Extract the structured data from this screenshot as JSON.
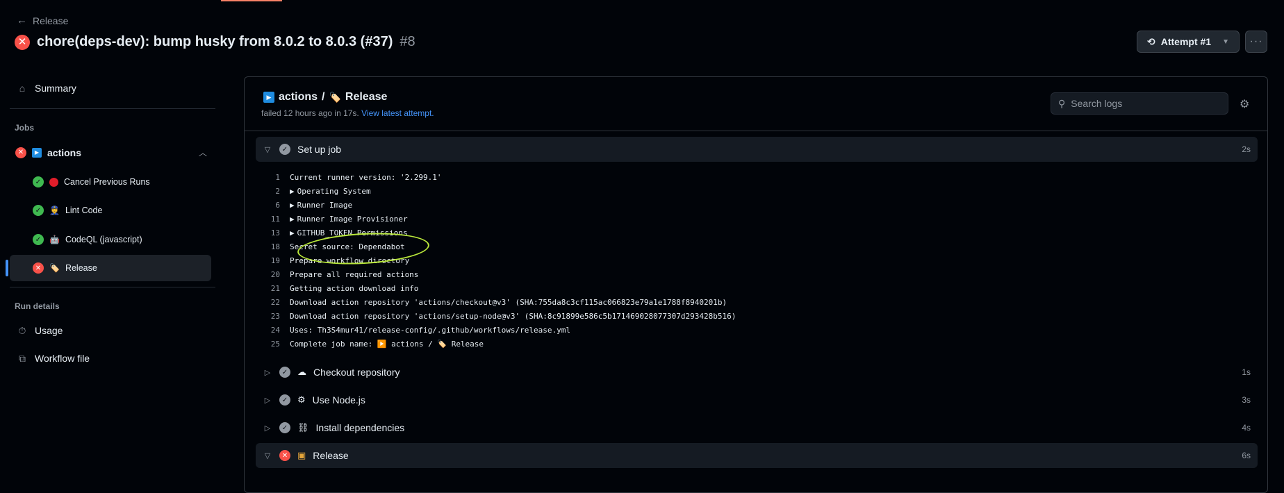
{
  "header": {
    "back_label": "Release",
    "run_title": "chore(deps-dev): bump husky from 8.0.2 to 8.0.3 (#37)",
    "run_number": "#8",
    "attempt_label": "Attempt #1",
    "more_label": "···"
  },
  "sidebar": {
    "summary_label": "Summary",
    "jobs_label": "Jobs",
    "job_group": "actions",
    "sub_jobs": [
      {
        "label": "Cancel Previous Runs",
        "status": "success"
      },
      {
        "label": "Lint Code",
        "status": "success"
      },
      {
        "label": "CodeQL (javascript)",
        "status": "success"
      },
      {
        "label": "Release",
        "status": "failure"
      }
    ],
    "run_details_label": "Run details",
    "usage_label": "Usage",
    "workflow_file_label": "Workflow file"
  },
  "panel": {
    "title_prefix": "actions",
    "title_sep": "/",
    "title_job": "Release",
    "status_text": "failed 12 hours ago in 17s.",
    "latest_link": "View latest attempt.",
    "search_placeholder": "Search logs"
  },
  "steps": [
    {
      "name": "Set up job",
      "duration": "2s",
      "status": "success",
      "expanded": true
    },
    {
      "name": "Checkout repository",
      "duration": "1s",
      "status": "success",
      "expanded": false
    },
    {
      "name": "Use Node.js",
      "duration": "3s",
      "status": "success",
      "expanded": false
    },
    {
      "name": "Install dependencies",
      "duration": "4s",
      "status": "success",
      "expanded": false
    },
    {
      "name": "Release",
      "duration": "6s",
      "status": "failure",
      "expanded": true
    }
  ],
  "log": [
    {
      "n": "1",
      "text": "Current runner version: '2.299.1'",
      "group": false
    },
    {
      "n": "2",
      "text": "Operating System",
      "group": true
    },
    {
      "n": "6",
      "text": "Runner Image",
      "group": true
    },
    {
      "n": "11",
      "text": "Runner Image Provisioner",
      "group": true
    },
    {
      "n": "13",
      "text": "GITHUB_TOKEN Permissions",
      "group": true
    },
    {
      "n": "18",
      "text": "Secret source: Dependabot",
      "group": false
    },
    {
      "n": "19",
      "text": "Prepare workflow directory",
      "group": false
    },
    {
      "n": "20",
      "text": "Prepare all required actions",
      "group": false
    },
    {
      "n": "21",
      "text": "Getting action download info",
      "group": false
    },
    {
      "n": "22",
      "text": "Download action repository 'actions/checkout@v3' (SHA:755da8c3cf115ac066823e79a1e1788f8940201b)",
      "group": false
    },
    {
      "n": "23",
      "text": "Download action repository 'actions/setup-node@v3' (SHA:8c91899e586c5b171469028077307d293428b516)",
      "group": false
    },
    {
      "n": "24",
      "text": "Uses: Th3S4mur41/release-config/.github/workflows/release.yml",
      "group": false
    },
    {
      "n": "25",
      "text": "Complete job name: ▶️ actions / 🏷️ Release",
      "group": false
    }
  ],
  "colors": {
    "failure": "#f85149",
    "success": "#3fb950",
    "link": "#4493f8",
    "annotation": "#b8e63a"
  }
}
